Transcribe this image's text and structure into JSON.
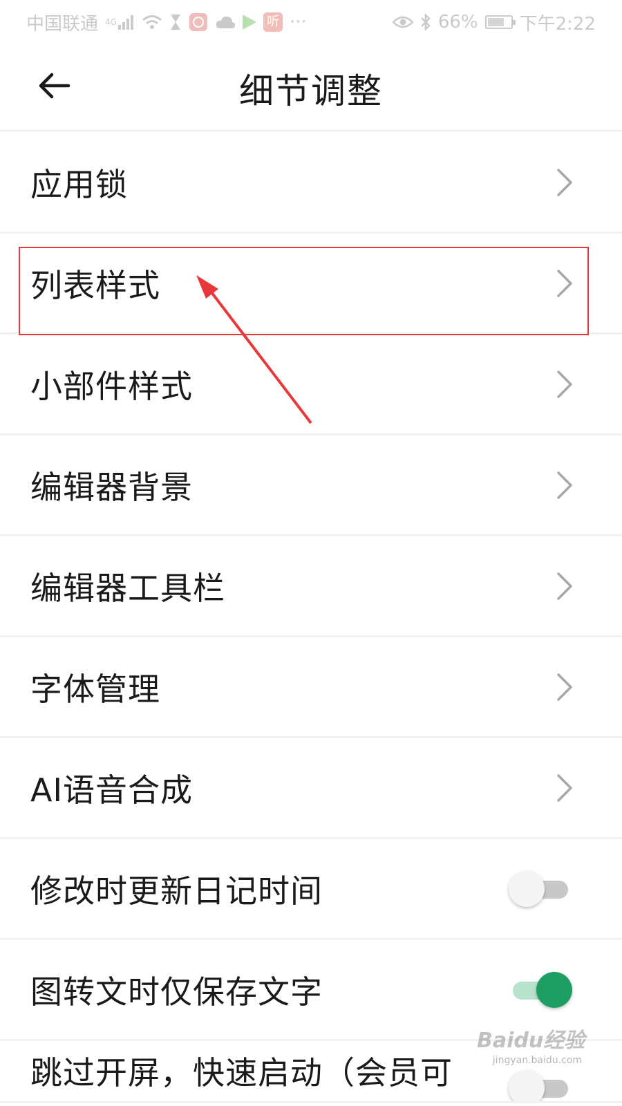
{
  "status_bar": {
    "carrier": "中国联通",
    "network_type": "4G",
    "more": "···",
    "badge_text": "听",
    "battery_percent": "66%",
    "time": "下午2:22"
  },
  "header": {
    "title": "细节调整"
  },
  "settings": {
    "items": [
      {
        "label": "应用锁"
      },
      {
        "label": "列表样式"
      },
      {
        "label": "小部件样式"
      },
      {
        "label": "编辑器背景"
      },
      {
        "label": "编辑器工具栏"
      },
      {
        "label": "字体管理"
      },
      {
        "label": "AI语音合成"
      },
      {
        "label": "修改时更新日记时间",
        "toggle": "off"
      },
      {
        "label": "图转文时仅保存文字",
        "toggle": "on"
      },
      {
        "label": "跳过开屏，快速启动（会员可"
      }
    ]
  },
  "colors": {
    "toggle_on": "#1f9e64",
    "annotation": "#e8383a"
  },
  "watermark": {
    "logo": "Baidu经验",
    "url": "jingyan.baidu.com"
  }
}
